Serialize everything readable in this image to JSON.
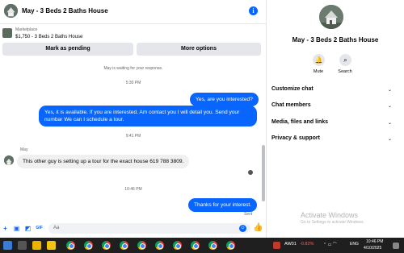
{
  "header": {
    "title": "May - 3 Beds 2 Baths House",
    "info_icon": "info-icon"
  },
  "listing": {
    "source": "Marketplace",
    "title": "$1,750 - 3 Beds 2 Baths House"
  },
  "actions": {
    "mark_pending": "Mark as pending",
    "more_options": "More options"
  },
  "messages": {
    "waiting_notice": "May is waiting for your response.",
    "time_1": "5:30 PM",
    "out_1": "Yes, are you interested?",
    "out_2": "Yes, it is available. If you are interested. Am contact you I will detail you. Send your numbar We can I schedule a tour.",
    "time_2": "9:41 PM",
    "sender": "May",
    "in_1": "This other guy is setting up a tour for the exact house 619 788 3809.",
    "time_3": "10:46 PM",
    "out_3": "Thanks for your interest.",
    "status": "Sent"
  },
  "composer": {
    "placeholder": "Aa",
    "icons": [
      "plus-icon",
      "image-icon",
      "sticker-icon",
      "gif-icon",
      "emoji-icon",
      "like-icon"
    ]
  },
  "info_panel": {
    "name": "May - 3 Beds 2 Baths House",
    "mute_label": "Mute",
    "search_label": "Search",
    "rows": [
      "Customize chat",
      "Chat members",
      "Media, files and links",
      "Privacy & support"
    ]
  },
  "watermark": {
    "title": "Activate Windows",
    "subtitle": "Go to Settings to activate Windows."
  },
  "taskbar": {
    "stock_name": "AW01",
    "stock_change": "-0.82%",
    "language": "ENG",
    "time": "10:46 PM",
    "date": "4/10/2025"
  },
  "colors": {
    "accent": "#0866ff",
    "bubble_in": "#f0f0f0",
    "stock_down": "#ff5c5c"
  }
}
